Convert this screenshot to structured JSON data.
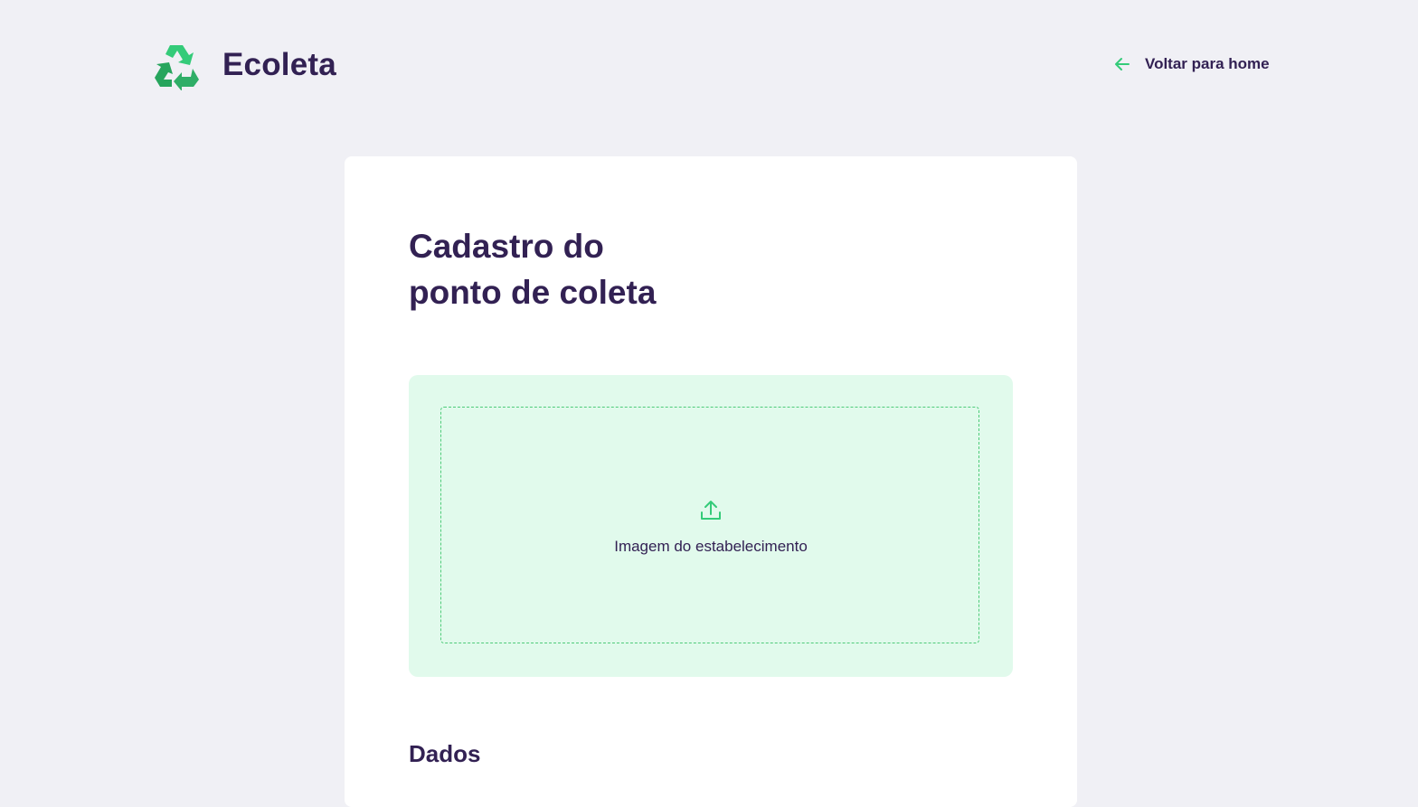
{
  "brand": {
    "name": "Ecoleta",
    "icon": "recycle-icon",
    "colors": {
      "primary": "#34CB79",
      "title": "#322153",
      "background": "#F0F0F5",
      "dropzone": "#E1FAEC"
    }
  },
  "header": {
    "back_link": {
      "label": "Voltar para home",
      "icon": "arrow-left-icon"
    }
  },
  "form": {
    "title_line1": "Cadastro do",
    "title_line2": "ponto de coleta",
    "dropzone": {
      "icon": "upload-icon",
      "label": "Imagem do estabelecimento"
    },
    "sections": [
      {
        "title": "Dados"
      }
    ]
  }
}
